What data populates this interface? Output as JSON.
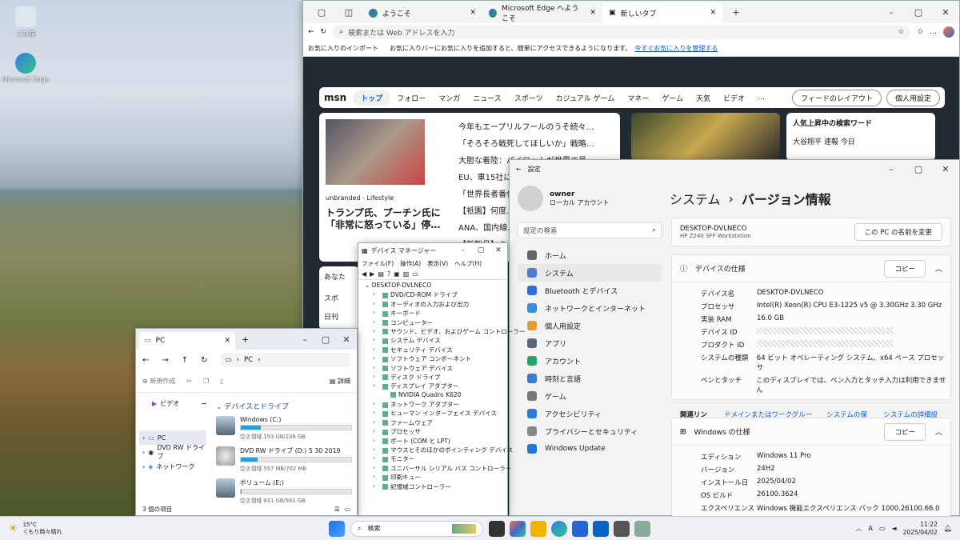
{
  "desktop": {
    "icons": [
      {
        "label": "ごみ箱"
      },
      {
        "label": "Microsoft Edge"
      }
    ]
  },
  "edge": {
    "tabs": [
      {
        "label": "ようこそ"
      },
      {
        "label": "Microsoft Edge へようこそ"
      },
      {
        "label": "新しいタブ"
      }
    ],
    "address_placeholder": "検索または Web アドレスを入力",
    "favbar": {
      "import": "お気に入りのインポート",
      "msg": "お気に入りバーにお気に入りを追加すると、簡単にアクセスできるようになります。",
      "link": "今すぐお気に入りを管理する"
    },
    "msn": {
      "logo": "msn",
      "tabs": [
        "トップ",
        "フォロー"
      ],
      "nav": [
        "マンガ",
        "ニュース",
        "スポーツ",
        "カジュアル ゲーム",
        "マネー",
        "ゲーム",
        "天気",
        "ビデオ"
      ],
      "more": "…",
      "feed_btn": "フィードのレイアウト",
      "personal_btn": "個人用設定",
      "main_source": "unbranded - Lifestyle",
      "main_headline": "トランプ氏、プーチン氏に「非常に怒っている」停…",
      "headlines": [
        "今年もエープリルフールのうそ続々…",
        "「そろそろ戦死してほしいか」戦略…",
        "大胆な着陸：パイロットが世界で最…",
        "EU、車15社に…",
        "「世界長者番付…",
        "【祇園】何度…",
        "ANA、国内線…",
        "【新製品】キ…"
      ],
      "trend_title": "人気上昇中の検索ワード",
      "trend_item": "大谷翔平 速報 今日",
      "left_partial": [
        "あなた",
        "スポ",
        "日刊"
      ]
    }
  },
  "settings": {
    "title": "設定",
    "user": "owner",
    "account": "ローカル アカウント",
    "search_placeholder": "設定の検索",
    "nav": [
      "ホーム",
      "システム",
      "Bluetooth とデバイス",
      "ネットワークとインターネット",
      "個人用設定",
      "アプリ",
      "アカウント",
      "時刻と言語",
      "ゲーム",
      "アクセシビリティ",
      "プライバシーとセキュリティ",
      "Windows Update"
    ],
    "breadcrumb_parent": "システム",
    "breadcrumb_sep": "›",
    "breadcrumb_current": "バージョン情報",
    "pc_name": "DESKTOP-DVLNECO",
    "pc_model": "HP Z240 SFF Workstation",
    "rename_btn": "この PC の名前を変更",
    "device_spec_title": "デバイスの仕様",
    "copy": "コピー",
    "device_spec": [
      {
        "k": "デバイス名",
        "v": "DESKTOP-DVLNECO"
      },
      {
        "k": "プロセッサ",
        "v": "Intel(R) Xeon(R) CPU E3-1225 v5 @ 3.30GHz   3.30 GHz"
      },
      {
        "k": "実装 RAM",
        "v": "16.0 GB"
      },
      {
        "k": "デバイス ID",
        "v": ""
      },
      {
        "k": "プロダクト ID",
        "v": ""
      },
      {
        "k": "システムの種類",
        "v": "64 ビット オペレーティング システム、x64 ベース プロセッサ"
      },
      {
        "k": "ペンとタッチ",
        "v": "このディスプレイでは、ペン入力とタッチ入力は利用できません"
      }
    ],
    "related": [
      "関連リンク",
      "ドメインまたはワークグループ",
      "システムの保護",
      "システムの詳細設定"
    ],
    "win_spec_title": "Windows の仕様",
    "win_spec": [
      {
        "k": "エディション",
        "v": "Windows 11 Pro"
      },
      {
        "k": "バージョン",
        "v": "24H2"
      },
      {
        "k": "インストール日",
        "v": "2025/04/02"
      },
      {
        "k": "OS ビルド",
        "v": "26100.3624"
      },
      {
        "k": "エクスペリエンス",
        "v": "Windows 機能エクスペリエンス パック 1000.26100.66.0"
      }
    ]
  },
  "devmgr": {
    "title": "デバイス マネージャー",
    "menu": [
      "ファイル(F)",
      "操作(A)",
      "表示(V)",
      "ヘルプ(H)"
    ],
    "root": "DESKTOP-DVLNECO",
    "nodes": [
      "DVD/CD-ROM ドライブ",
      "オーディオの入力および出力",
      "キーボード",
      "コンピューター",
      "サウンド、ビデオ、およびゲーム コントローラー",
      "システム デバイス",
      "セキュリティ デバイス",
      "ソフトウェア コンポーネント",
      "ソフトウェア デバイス",
      "ディスク ドライブ",
      "ディスプレイ アダプター",
      "NVIDIA Quadro K620",
      "ネットワーク アダプター",
      "ヒューマン インターフェイス デバイス",
      "ファームウェア",
      "プロセッサ",
      "ポート (COM と LPT)",
      "マウスとそのほかのポインティング デバイス",
      "モニター",
      "ユニバーサル シリアル バス コントローラー",
      "印刷キュー",
      "記憶域コントローラー"
    ]
  },
  "explorer": {
    "tab": "PC",
    "path": "PC",
    "newbtn": "新規作成",
    "details": "詳細",
    "pinned": "ビデオ",
    "section": "デバイスとドライブ",
    "side": [
      "PC",
      "DVD RW ドライブ",
      "ネットワーク"
    ],
    "drives": [
      {
        "name": "Windows (C:)",
        "free": "空き領域 193 GB/236 GB",
        "fill": 0.18
      },
      {
        "name": "DVD RW ドライブ (D:) 5 30 2019",
        "free": "空き領域 597 MB/702 MB",
        "fill": 0.15
      },
      {
        "name": "ボリューム (E:)",
        "free": "空き領域 931 GB/931 GB",
        "fill": 0.01
      }
    ],
    "status": "3 個の項目"
  },
  "taskbar": {
    "temp": "15°C",
    "weather": "くもり時々晴れ",
    "search": "検索",
    "time": "11:22",
    "date": "2025/04/02"
  }
}
